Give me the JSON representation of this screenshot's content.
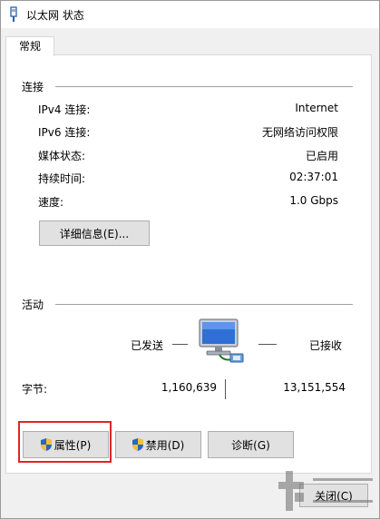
{
  "window": {
    "title": "以太网 状态"
  },
  "tabs": [
    {
      "label": "常规"
    }
  ],
  "connection": {
    "section_title": "连接",
    "rows": [
      {
        "label": "IPv4 连接:",
        "value": "Internet"
      },
      {
        "label": "IPv6 连接:",
        "value": "无网络访问权限"
      },
      {
        "label": "媒体状态:",
        "value": "已启用"
      },
      {
        "label": "持续时间:",
        "value": "02:37:01"
      },
      {
        "label": "速度:",
        "value": "1.0 Gbps"
      }
    ],
    "details_button": "详细信息(E)..."
  },
  "activity": {
    "section_title": "活动",
    "sent_label": "已发送",
    "received_label": "已接收",
    "bytes_label": "字节:",
    "bytes_sent": "1,160,639",
    "bytes_received": "13,151,554"
  },
  "buttons": {
    "properties": "属性(P)",
    "disable": "禁用(D)",
    "diagnose": "诊断(G)",
    "close": "关闭(C)"
  },
  "icons": {
    "title": "network-adapter-icon",
    "network": "network-computer-icon",
    "shield": "uac-shield-icon"
  },
  "colors": {
    "highlight": "#e0242b",
    "window_bg": "#f0f0f0",
    "panel_bg": "#ffffff"
  }
}
